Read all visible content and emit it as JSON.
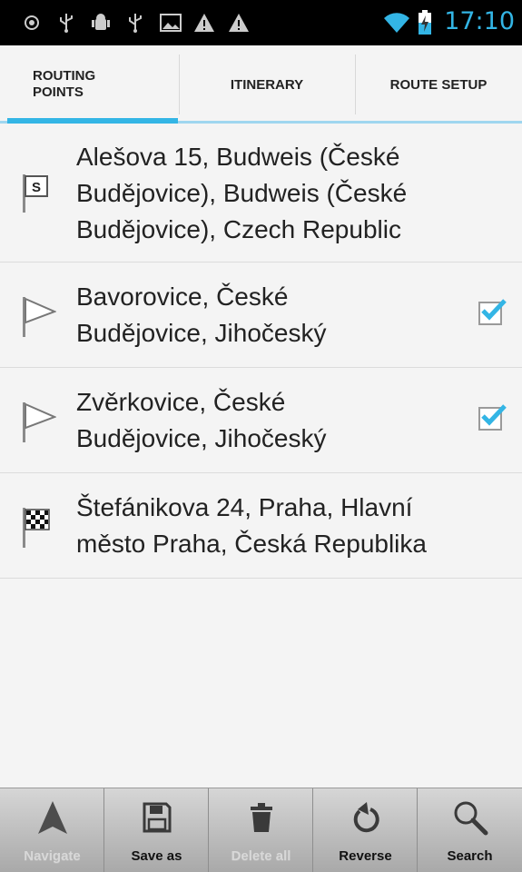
{
  "status_bar": {
    "time": "17:10",
    "accent": "#33b5e5",
    "icons": [
      "gps-icon",
      "usb-icon",
      "android-debug-icon",
      "usb-icon",
      "image-icon",
      "warning-icon",
      "warning-icon",
      "wifi-icon",
      "battery-charging-icon"
    ]
  },
  "tabs": [
    {
      "label_line1": "ROUTING",
      "label_line2": "POINTS",
      "active": true
    },
    {
      "label": "ITINERARY",
      "active": false
    },
    {
      "label": "ROUTE SETUP",
      "active": false
    }
  ],
  "routing_points": [
    {
      "icon": "start-flag-icon",
      "lines": [
        "Alešova 15, Budweis (České",
        "Budějovice), Budweis (České",
        "Budějovice), Czech Republic"
      ],
      "has_checkbox": false
    },
    {
      "icon": "waypoint-flag-icon",
      "lines": [
        "Bavorovice, České",
        "Budějovice, Jihočeský"
      ],
      "has_checkbox": true,
      "checked": true
    },
    {
      "icon": "waypoint-flag-icon",
      "lines": [
        "Zvěrkovice, České",
        "Budějovice, Jihočeský"
      ],
      "has_checkbox": true,
      "checked": true
    },
    {
      "icon": "finish-flag-icon",
      "lines": [
        "Štefánikova 24, Praha, Hlavní",
        "město Praha, Česká Republika"
      ],
      "has_checkbox": false
    }
  ],
  "bottom_bar": [
    {
      "label": "Navigate",
      "icon": "navigate-arrow-icon",
      "enabled": false
    },
    {
      "label": "Save as",
      "icon": "save-icon",
      "enabled": true
    },
    {
      "label": "Delete all",
      "icon": "trash-icon",
      "enabled": false
    },
    {
      "label": "Reverse",
      "icon": "reverse-icon",
      "enabled": true
    },
    {
      "label": "Search",
      "icon": "search-icon",
      "enabled": true
    }
  ]
}
